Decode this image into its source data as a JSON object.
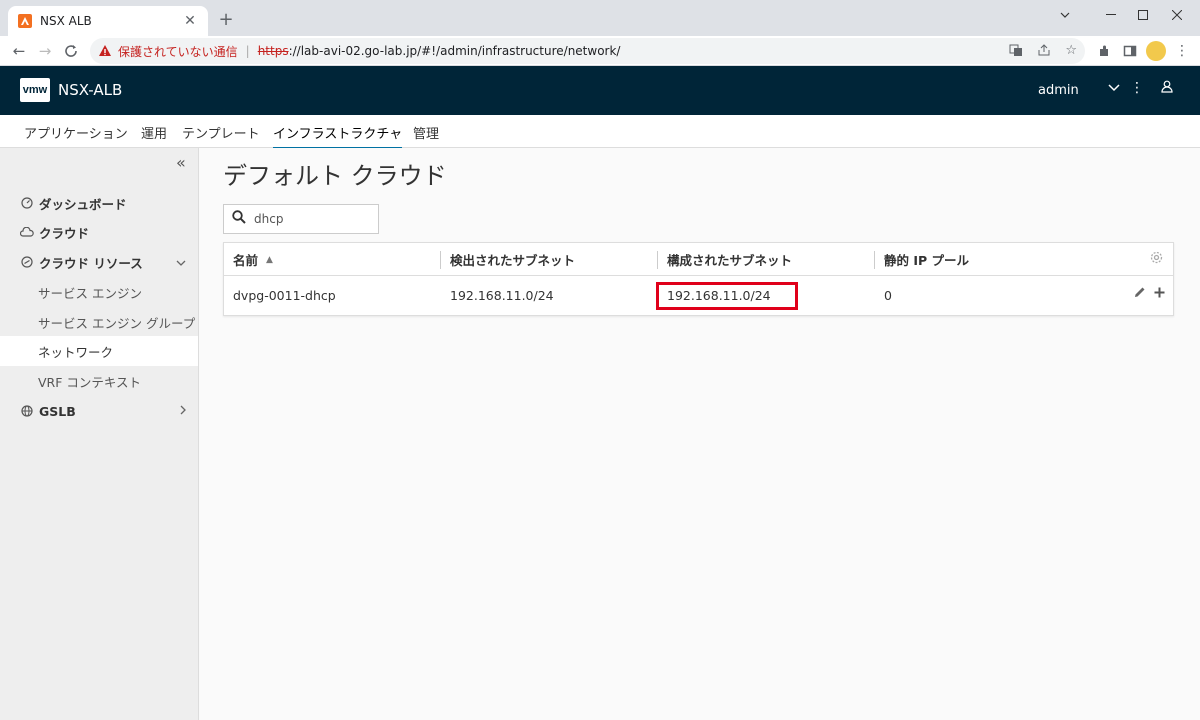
{
  "browser": {
    "tab_title": "NSX ALB",
    "new_tab": "+",
    "security_label": "保護されていない通信",
    "url_scheme": "https",
    "url_rest": "://lab-avi-02.go-lab.jp/#!/admin/infrastructure/network/"
  },
  "app": {
    "logo": "vmw",
    "name": "NSX-ALB",
    "user": "admin"
  },
  "mainnav": [
    {
      "label": "アプリケーション"
    },
    {
      "label": "運用"
    },
    {
      "label": "テンプレート"
    },
    {
      "label": "インフラストラクチャ"
    },
    {
      "label": "管理"
    }
  ],
  "sidebar": {
    "items": [
      {
        "label": "ダッシュボード",
        "icon": "dashboard-icon"
      },
      {
        "label": "クラウド",
        "icon": "cloud-icon"
      },
      {
        "label": "クラウド リソース",
        "icon": "resources-icon"
      },
      {
        "label": "GSLB",
        "icon": "globe-icon"
      }
    ],
    "subitems": [
      {
        "label": "サービス エンジン"
      },
      {
        "label": "サービス エンジン グループ"
      },
      {
        "label": "ネットワーク"
      },
      {
        "label": "VRF コンテキスト"
      }
    ]
  },
  "main": {
    "title": "デフォルト クラウド",
    "search_value": "dhcp",
    "columns": [
      "名前",
      "検出されたサブネット",
      "構成されたサブネット",
      "静的 IP プール"
    ],
    "rows": [
      {
        "name": "dvpg-0011-dhcp",
        "discovered": "192.168.11.0/24",
        "configured": "192.168.11.0/24",
        "static_pool": "0"
      }
    ]
  },
  "colors": {
    "header_bg": "#002538",
    "accent": "#0072a3",
    "highlight_border": "#e0001a"
  }
}
